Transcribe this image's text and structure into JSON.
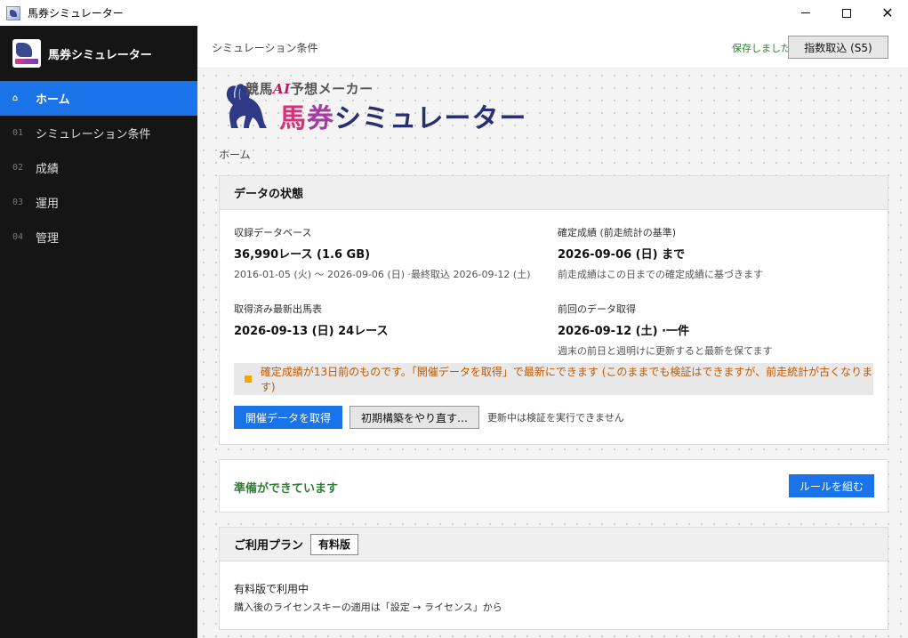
{
  "window": {
    "title": "馬券シミュレーター"
  },
  "sidebar": {
    "brand": "馬券シミュレーター",
    "items": [
      {
        "num": "⌂",
        "label": "ホーム"
      },
      {
        "num": "01",
        "label": "シミュレーション条件"
      },
      {
        "num": "02",
        "label": "成績"
      },
      {
        "num": "03",
        "label": "運用"
      },
      {
        "num": "04",
        "label": "管理"
      }
    ]
  },
  "header": {
    "crumb": "シミュレーション条件",
    "saved": "保存しました",
    "import_label": "指数取込 (S5)"
  },
  "logo": {
    "small_pre": "競馬",
    "small_ai": "AI",
    "small_post": "予想メーカー",
    "big_1": "馬",
    "big_2": "券",
    "big_3": "シミュレーター"
  },
  "breadcrumb": "ホーム",
  "status": {
    "title": "データの状態",
    "db_label": "収録データベース",
    "db_value": "36,990レース (1.6 GB)",
    "db_sub": "2016-01-05 (火) ～ 2026-09-06 (日) ·最終取込 2026-09-12 (土)",
    "confirmed_label": "確定成績 (前走統計の基準)",
    "confirmed_value": "2026-09-06 (日) まで",
    "confirmed_sub": "前走成績はこの日までの確定成績に基づきます",
    "latest_label": "取得済み最新出馬表",
    "latest_value": "2026-09-13 (日) 24レース",
    "prev_label": "前回のデータ取得",
    "prev_value": "2026-09-12 (土) ·一件",
    "prev_sub": "週末の前日と週明けに更新すると最新を保てます",
    "warning": "確定成績が13日前のものです。「開催データを取得」で最新にできます (このままでも検証はできますが、前走統計が古くなります)",
    "fetch_btn": "開催データを取得",
    "rebuild_btn": "初期構築をやり直す…",
    "note": "更新中は検証を実行できません"
  },
  "ready": {
    "text": "準備ができています",
    "button": "ルールを組む"
  },
  "plan": {
    "title": "ご利用プラン",
    "badge": "有料版",
    "line1": "有料版で利用中",
    "line2": "購入後のライセンスキーの適用は「設定 → ライセンス」から"
  }
}
